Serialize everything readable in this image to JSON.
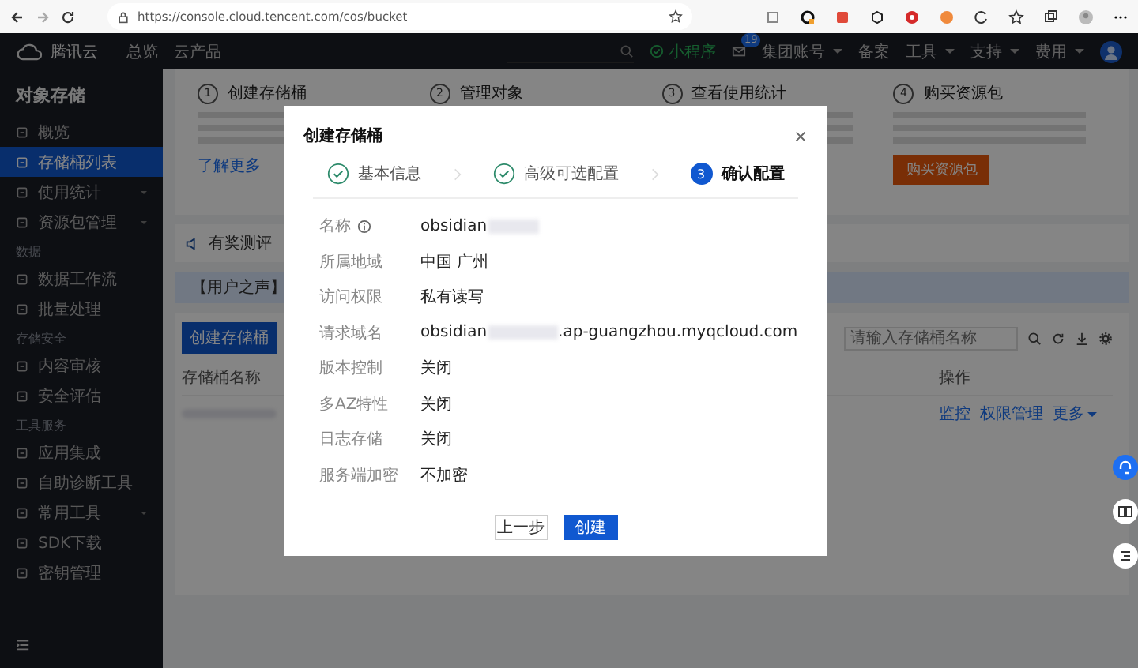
{
  "browser": {
    "url": "https://console.cloud.tencent.com/cos/bucket"
  },
  "topnav": {
    "logo": "腾讯云",
    "links": [
      "总览",
      "云产品"
    ],
    "mini_program": "小程序",
    "mail_badge": "19",
    "right_links": [
      "集团账号",
      "备案",
      "工具",
      "支持",
      "费用"
    ]
  },
  "sidebar": {
    "title": "对象存储",
    "sections": [
      {
        "items": [
          {
            "label": "概览",
            "selected": false,
            "has_submenu": false
          },
          {
            "label": "存储桶列表",
            "selected": true,
            "has_submenu": false
          },
          {
            "label": "使用统计",
            "selected": false,
            "has_submenu": true
          },
          {
            "label": "资源包管理",
            "selected": false,
            "has_submenu": true
          }
        ]
      },
      {
        "label": "数据",
        "items": [
          {
            "label": "数据工作流",
            "selected": false,
            "has_submenu": false
          },
          {
            "label": "批量处理",
            "selected": false,
            "has_submenu": false
          }
        ]
      },
      {
        "label": "存储安全",
        "items": [
          {
            "label": "内容审核",
            "selected": false,
            "has_submenu": false
          },
          {
            "label": "安全评估",
            "selected": false,
            "has_submenu": false
          }
        ]
      },
      {
        "label": "工具服务",
        "items": [
          {
            "label": "应用集成",
            "selected": false,
            "has_submenu": false
          },
          {
            "label": "自助诊断工具",
            "selected": false,
            "has_submenu": false
          },
          {
            "label": "常用工具",
            "selected": false,
            "has_submenu": true
          },
          {
            "label": "SDK下载",
            "selected": false,
            "has_submenu": false
          },
          {
            "label": "密钥管理",
            "selected": false,
            "has_submenu": false
          }
        ]
      }
    ]
  },
  "guide_steps": [
    {
      "number": "1",
      "title": "创建存储桶",
      "action": {
        "kind": "link",
        "label": "了解更多"
      }
    },
    {
      "number": "2",
      "title": "管理对象"
    },
    {
      "number": "3",
      "title": "查看使用统计"
    },
    {
      "number": "4",
      "title": "购买资源包",
      "action": {
        "kind": "button",
        "label": "购买资源包"
      }
    }
  ],
  "notice": "有奖测评",
  "banner": "【用户之声】",
  "bucket_list": {
    "create_button": "创建存储桶",
    "search": {
      "placeholder": "请输入存储桶名称"
    },
    "columns": [
      "存储桶名称",
      "操作"
    ],
    "row_actions": [
      "监控",
      "权限管理",
      "更多"
    ]
  },
  "dialog": {
    "title": "创建存储桶",
    "steps": [
      {
        "label": "基本信息",
        "completed": true
      },
      {
        "label": "高级可选配置",
        "completed": true
      },
      {
        "number": "3",
        "label": "确认配置",
        "completed": false
      }
    ],
    "fields": [
      {
        "label": "名称",
        "info": true,
        "value": "obsidian",
        "redacted": true
      },
      {
        "label": "所属地域",
        "value": "中国 广州"
      },
      {
        "label": "访问权限",
        "value": "私有读写"
      },
      {
        "label": "请求域名",
        "value": "obsidian",
        "redacted": true,
        "suffix": ".ap-guangzhou.myqcloud.com"
      },
      {
        "label": "版本控制",
        "value": "关闭"
      },
      {
        "label": "多AZ特性",
        "value": "关闭"
      },
      {
        "label": "日志存储",
        "value": "关闭"
      },
      {
        "label": "服务端加密",
        "value": "不加密"
      }
    ],
    "buttons": [
      {
        "label": "上一步",
        "primary": false
      },
      {
        "label": "创建",
        "primary": true
      }
    ]
  }
}
